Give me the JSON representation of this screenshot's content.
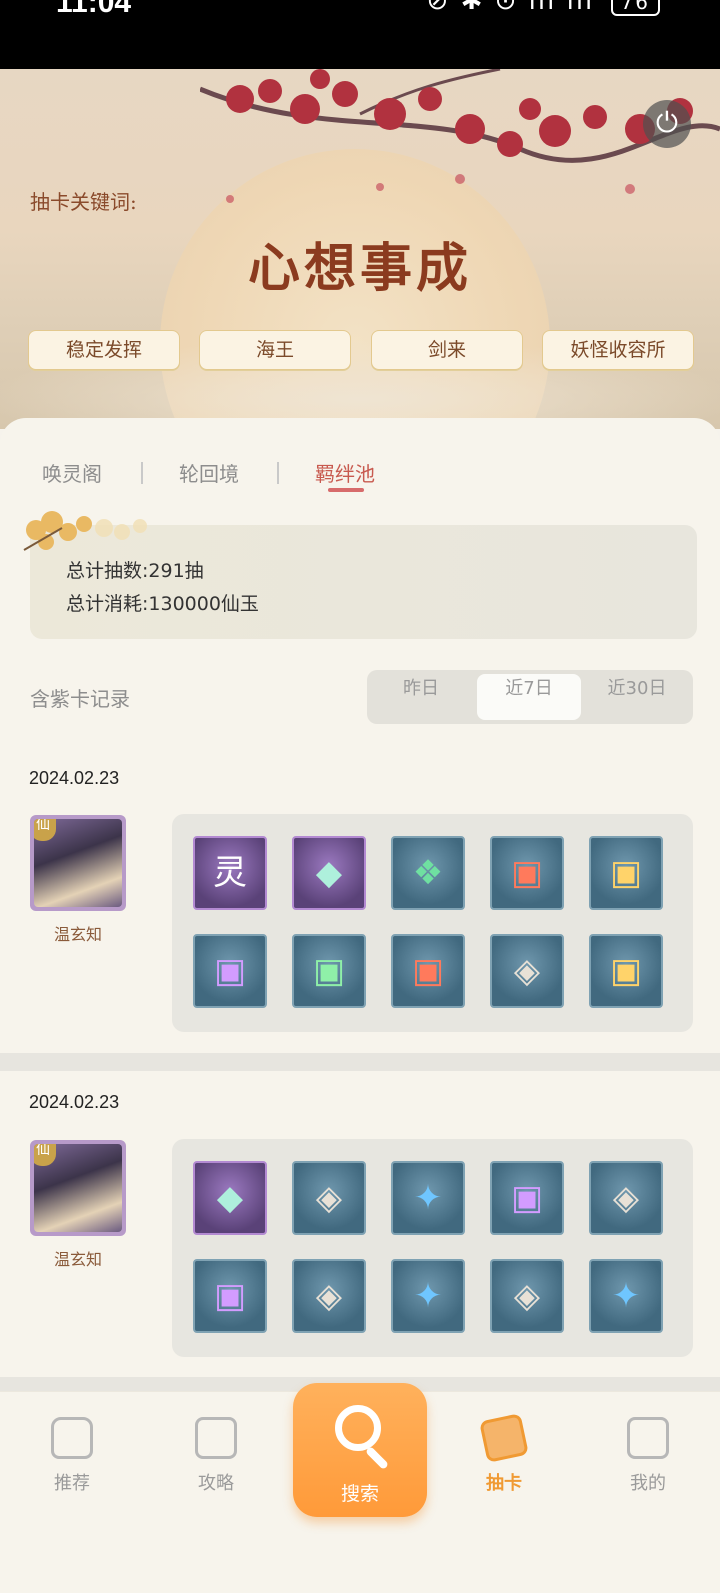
{
  "status_bar": {
    "time": "11:04",
    "icons": "⊘ ✱ ⊙ ıll ıll",
    "battery": "76"
  },
  "header": {
    "keyword_label": "抽卡关键词:",
    "keyword_title": "心想事成",
    "tags": [
      "稳定发挥",
      "海王",
      "剑来",
      "妖怪收容所"
    ]
  },
  "tabs": {
    "items": [
      "唤灵阁",
      "轮回境",
      "羁绊池"
    ],
    "active_index": 2
  },
  "summary": {
    "total_draws": "总计抽数:291抽",
    "total_cost": "总计消耗:130000仙玉"
  },
  "records": {
    "label": "含紫卡记录",
    "ranges": [
      "昨日",
      "近7日",
      "近30日"
    ],
    "active_range": 1
  },
  "entries": [
    {
      "date": "2024.02.23",
      "hero_name": "温玄知",
      "hero_badge": "仙",
      "items": [
        {
          "icon": "character-card-icon",
          "rarity": "purple",
          "glyph": "灵"
        },
        {
          "icon": "jade-cloth-icon",
          "rarity": "purple",
          "glyph": "◆"
        },
        {
          "icon": "green-scroll-icon",
          "rarity": "blue",
          "glyph": "❖"
        },
        {
          "icon": "red-chest-icon",
          "rarity": "blue",
          "glyph": "▣"
        },
        {
          "icon": "gold-chest-icon",
          "rarity": "blue",
          "glyph": "▣"
        },
        {
          "icon": "purple-chest-icon",
          "rarity": "blue",
          "glyph": "▣"
        },
        {
          "icon": "green-chest-icon",
          "rarity": "blue",
          "glyph": "▣"
        },
        {
          "icon": "red-chest-icon",
          "rarity": "blue",
          "glyph": "▣"
        },
        {
          "icon": "ore-stone-icon",
          "rarity": "blue",
          "glyph": "◈"
        },
        {
          "icon": "gold-chest-icon",
          "rarity": "blue",
          "glyph": "▣"
        }
      ]
    },
    {
      "date": "2024.02.23",
      "hero_name": "温玄知",
      "hero_badge": "仙",
      "items": [
        {
          "icon": "jade-cloth-icon",
          "rarity": "purple",
          "glyph": "◆"
        },
        {
          "icon": "ore-stone-icon",
          "rarity": "blue",
          "glyph": "◈"
        },
        {
          "icon": "blue-flame-icon",
          "rarity": "blue",
          "glyph": "✦"
        },
        {
          "icon": "purple-chest-icon",
          "rarity": "blue",
          "glyph": "▣"
        },
        {
          "icon": "ore-stone-icon",
          "rarity": "blue",
          "glyph": "◈"
        },
        {
          "icon": "purple-chest-icon",
          "rarity": "blue",
          "glyph": "▣"
        },
        {
          "icon": "ore-stone-icon",
          "rarity": "blue",
          "glyph": "◈"
        },
        {
          "icon": "blue-flame-icon",
          "rarity": "blue",
          "glyph": "✦"
        },
        {
          "icon": "ore-stone-icon",
          "rarity": "blue",
          "glyph": "◈"
        },
        {
          "icon": "blue-flame-icon",
          "rarity": "blue",
          "glyph": "✦"
        }
      ]
    }
  ],
  "nav": {
    "items": [
      {
        "label": "推荐",
        "icon": "home-heart-icon"
      },
      {
        "label": "攻略",
        "icon": "guide-book-icon"
      },
      {
        "label": "搜索",
        "icon": "search-icon"
      },
      {
        "label": "抽卡",
        "icon": "cards-icon"
      },
      {
        "label": "我的",
        "icon": "profile-icon"
      }
    ],
    "active_index": 3
  },
  "colors": {
    "accent": "#f09a33",
    "tab_active": "#c85a4f",
    "title": "#8b3b1f"
  }
}
